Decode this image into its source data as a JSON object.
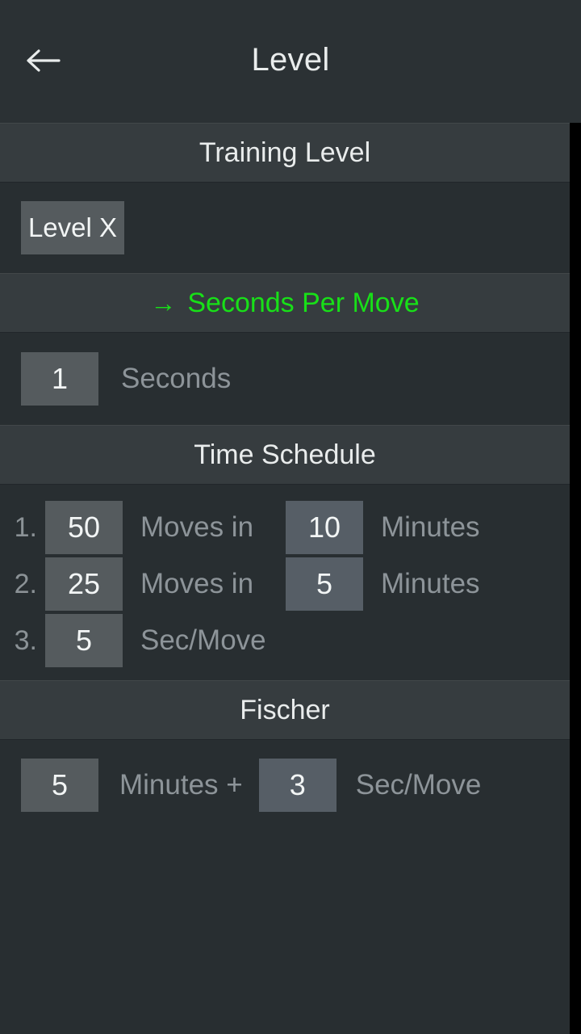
{
  "window": {
    "background_color": "#282e31",
    "accent_color": "#18e018"
  },
  "toolbar": {
    "title": "Level",
    "back_icon": "arrow-left-icon"
  },
  "sections": {
    "training_level": {
      "header": "Training Level",
      "level_button": "Level X"
    },
    "seconds_per_move": {
      "header": "Seconds Per Move",
      "arrow_glyph": "→",
      "active": "true",
      "value": "1",
      "label": "Seconds"
    },
    "time_schedule": {
      "header": "Time Schedule",
      "rows": [
        {
          "index": "1.",
          "moves": "50",
          "moves_label": "Moves in",
          "minutes": "10",
          "minutes_label": "Minutes"
        },
        {
          "index": "2.",
          "moves": "25",
          "moves_label": "Moves in",
          "minutes": "5",
          "minutes_label": "Minutes"
        },
        {
          "index": "3.",
          "moves": "5",
          "moves_label": "Sec/Move"
        }
      ]
    },
    "fischer": {
      "header": "Fischer",
      "minutes": "5",
      "minutes_label": "Minutes +",
      "seconds": "3",
      "seconds_label": "Sec/Move"
    }
  }
}
